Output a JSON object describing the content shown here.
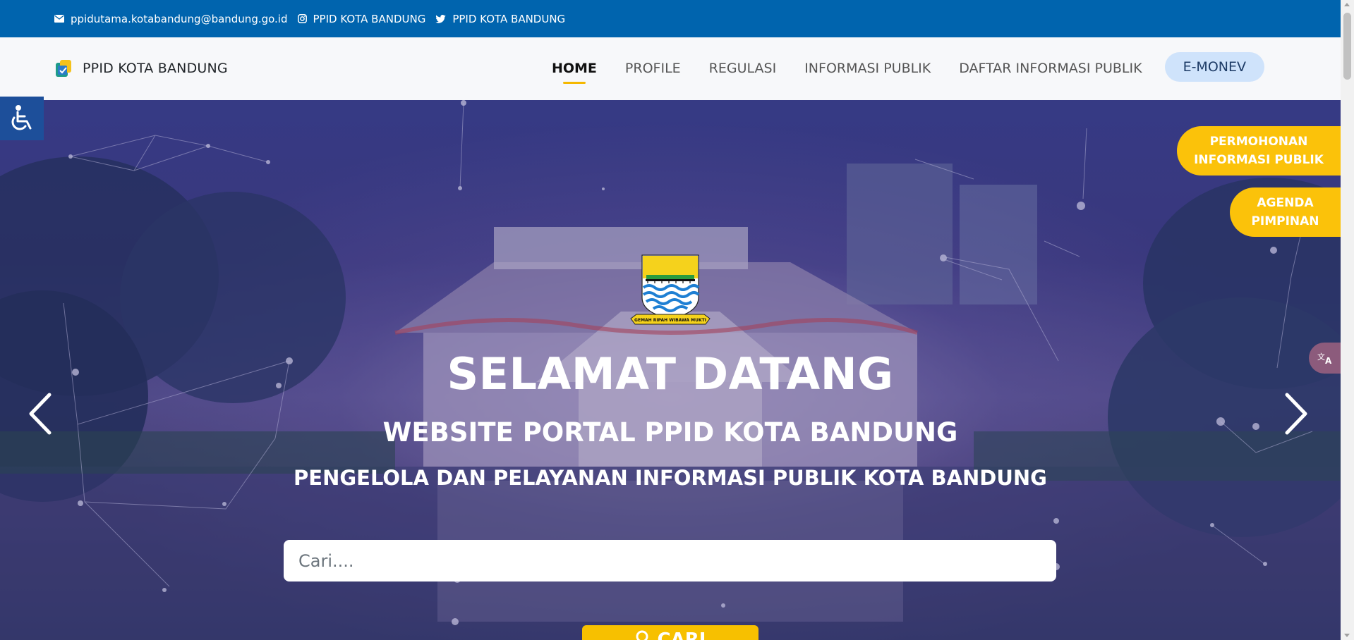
{
  "topbar": {
    "email": "ppidutama.kotabandung@bandung.go.id",
    "instagram": "PPID KOTA BANDUNG",
    "twitter": "PPID KOTA BANDUNG",
    "email_icon": "envelope-icon",
    "instagram_icon": "instagram-icon",
    "twitter_icon": "twitter-icon",
    "background": "#0064ae"
  },
  "header": {
    "brand_name": "PPID KOTA BANDUNG",
    "nav": [
      {
        "label": "HOME",
        "active": true
      },
      {
        "label": "PROFILE"
      },
      {
        "label": "REGULASI"
      },
      {
        "label": "INFORMASI PUBLIK"
      },
      {
        "label": "DAFTAR INFORMASI PUBLIK"
      }
    ],
    "emonev_label": "E-MONEV"
  },
  "hero": {
    "crest_motto": "GEMAH RIPAH WIBAWA MUKTI",
    "title": "SELAMAT DATANG",
    "subtitle": "WEBSITE PORTAL PPID KOTA BANDUNG",
    "subtitle2": "PENGELOLA DAN PELAYANAN INFORMASI PUBLIK KOTA BANDUNG",
    "search_placeholder": "Cari....",
    "search_button": "CARI"
  },
  "side_tabs": {
    "permohonan": "PERMOHONAN INFORMASI PUBLIK",
    "agenda": "AGENDA PIMPINAN"
  },
  "colors": {
    "accent": "#fbc20a",
    "primary": "#0064ae",
    "emonev_bg": "#cfe3fb"
  }
}
